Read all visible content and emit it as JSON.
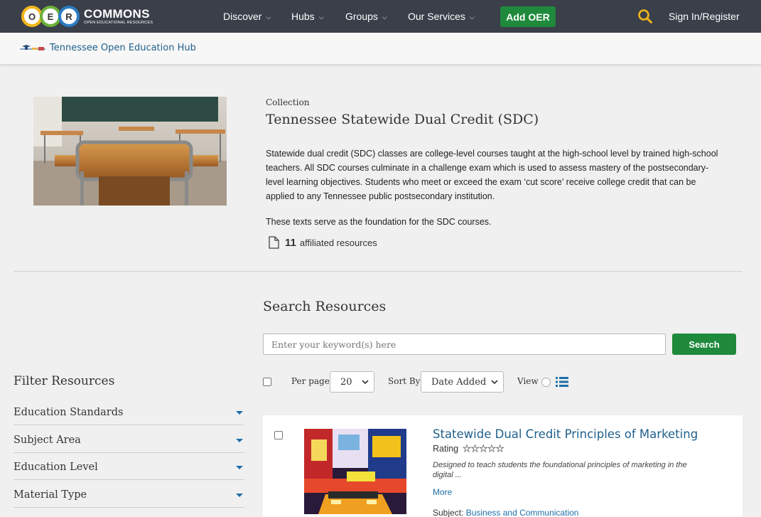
{
  "nav": {
    "logo_letters": [
      "O",
      "E",
      "R"
    ],
    "logo_word": "COMMONS",
    "logo_tagline": "OPEN EDUCATIONAL RESOURCES",
    "items": [
      {
        "label": "Discover"
      },
      {
        "label": "Hubs"
      },
      {
        "label": "Groups"
      },
      {
        "label": "Our Services"
      }
    ],
    "add_oer": "Add OER",
    "search_icon": "search-icon",
    "sign_in": "Sign In/Register",
    "colors": {
      "bar": "#3a3f4a",
      "green": "#1f8a3c",
      "search": "#f2b61b"
    }
  },
  "hub": {
    "name": "Tennessee Open Education Hub"
  },
  "collection": {
    "type_label": "Collection",
    "title": "Tennessee Statewide Dual Credit (SDC)",
    "description": "Statewide dual credit (SDC) classes are college-level courses taught at the high-school level by trained high-school teachers. All SDC courses culminate in a challenge exam which is used to assess mastery of the postsecondary-level learning objectives. Students who meet or exceed the exam ‘cut score’ receive college credit that can be applied to any Tennessee public postsecondary institution.",
    "description2": "These texts serve as the foundation for the SDC courses.",
    "affiliated_count": "11",
    "affiliated_label": "affiliated resources"
  },
  "search": {
    "title": "Search Resources",
    "placeholder": "Enter your keyword(s) here",
    "button": "Search",
    "per_page_label": "Per page",
    "per_page_value": "20",
    "sort_label": "Sort By",
    "sort_value": "Date Added",
    "view_label": "View"
  },
  "filters": {
    "title": "Filter Resources",
    "facets": [
      {
        "label": "Education Standards"
      },
      {
        "label": "Subject Area"
      },
      {
        "label": "Education Level"
      },
      {
        "label": "Material Type"
      }
    ]
  },
  "results": [
    {
      "title": "Statewide Dual Credit Principles of Marketing",
      "rating_label": "Rating",
      "rating": 0,
      "rating_max": 5,
      "description": "Designed to teach students the foundational principles of marketing in the digital ...",
      "more": "More",
      "subject_label": "Subject:",
      "subject_value": "Business and Communication"
    }
  ]
}
